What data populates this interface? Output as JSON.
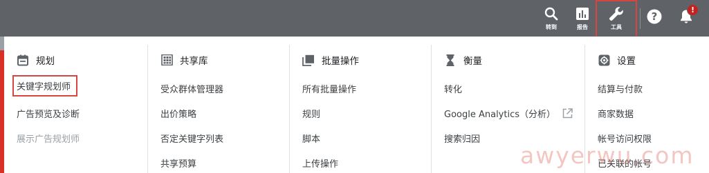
{
  "topbar": {
    "search_label": "转到",
    "report_label": "报告",
    "tools_label": "工具",
    "notification_badge": "!"
  },
  "columns": [
    {
      "heading": "规划",
      "icon": "calendar-icon",
      "items": [
        {
          "label": "关键字规划师",
          "highlighted": true
        },
        {
          "label": "广告预览及诊断"
        },
        {
          "label": "展示广告规划师",
          "disabled": true
        }
      ]
    },
    {
      "heading": "共享库",
      "icon": "library-grid-icon",
      "items": [
        {
          "label": "受众群体管理器"
        },
        {
          "label": "出价策略"
        },
        {
          "label": "否定关键字列表"
        },
        {
          "label": "共享预算"
        }
      ]
    },
    {
      "heading": "批量操作",
      "icon": "copy-stack-icon",
      "items": [
        {
          "label": "所有批量操作"
        },
        {
          "label": "规则"
        },
        {
          "label": "脚本"
        },
        {
          "label": "上传操作"
        }
      ]
    },
    {
      "heading": "衡量",
      "icon": "hourglass-icon",
      "items": [
        {
          "label": "转化"
        },
        {
          "label": "Google Analytics（分析）",
          "external": true
        },
        {
          "label": "搜索归因"
        }
      ]
    },
    {
      "heading": "设置",
      "icon": "gear-icon",
      "items": [
        {
          "label": "结算与付款"
        },
        {
          "label": "商家数据"
        },
        {
          "label": "帐号访问权限"
        },
        {
          "label": "已关联的帐号"
        }
      ]
    }
  ],
  "watermark": "awyerwu.com",
  "colors": {
    "topbar": "#5f6368",
    "highlight_box": "#d64541",
    "badge": "#c5221f",
    "watermark": "#e2786e"
  }
}
